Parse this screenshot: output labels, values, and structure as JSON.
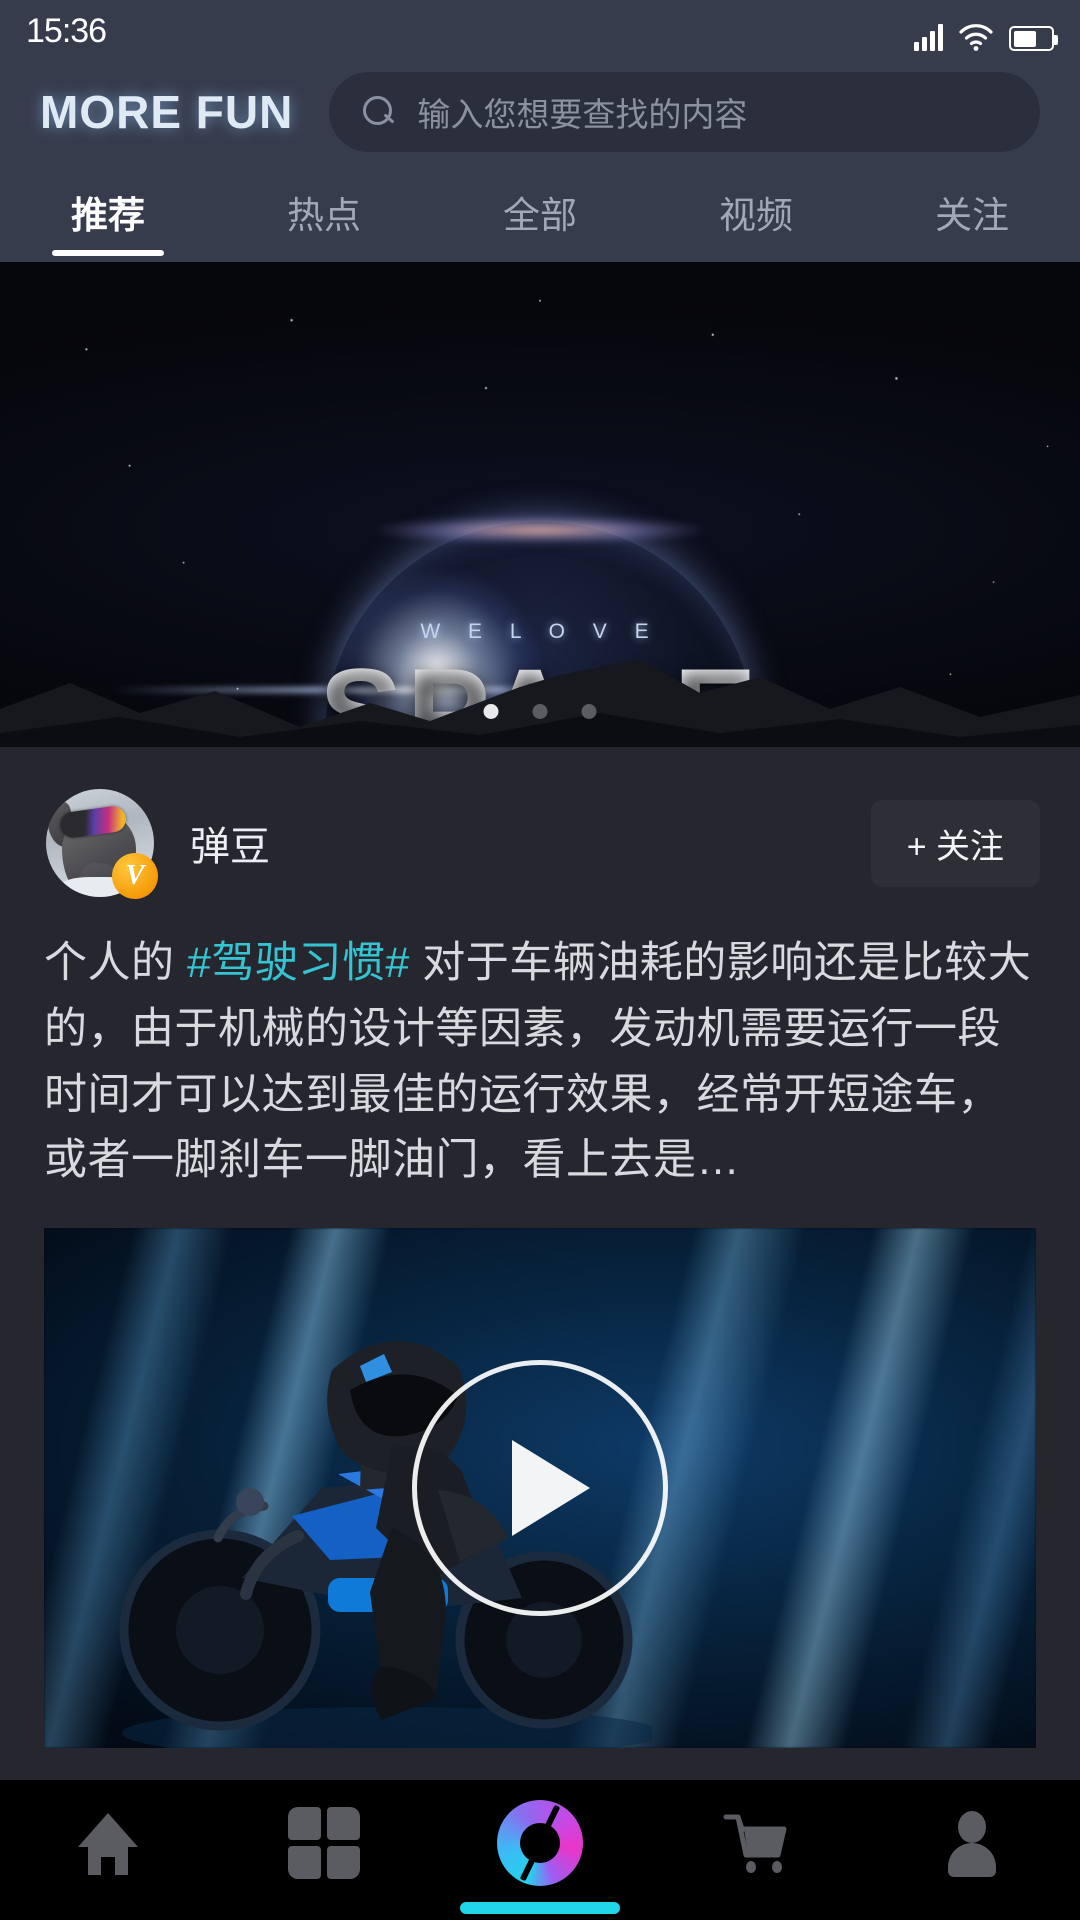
{
  "statusbar": {
    "time": "15:36",
    "signal_icon": "cellular-signal-icon",
    "wifi_icon": "wifi-icon",
    "battery_icon": "battery-icon",
    "battery_level_percent": 62
  },
  "header": {
    "logo": "MORE FUN",
    "search": {
      "icon": "search-icon",
      "placeholder": "输入您想要查找的内容",
      "value": ""
    }
  },
  "tabs": {
    "active_index": 0,
    "items": [
      {
        "label": "推荐"
      },
      {
        "label": "热点"
      },
      {
        "label": "全部"
      },
      {
        "label": "视频"
      },
      {
        "label": "关注"
      }
    ]
  },
  "banner": {
    "subtitle": "W E   L O V E",
    "title": "SPACE",
    "dots_total": 3,
    "dots_active": 1
  },
  "post": {
    "author": {
      "name": "弹豆",
      "avatar_icon": "dog-avatar",
      "verified_badge": "V"
    },
    "follow_button": "+ 关注",
    "text_before": "个人的 ",
    "hashtag": "#驾驶习惯#",
    "text_after": " 对于车辆油耗的影响还是比较大的，由于机械的设计等因素，发动机需要运行一段时间才可以达到最佳的运行效果，经常开短途车，或者一脚刹车一脚油门，看上去是…",
    "media": {
      "type": "video",
      "play_icon": "play-icon",
      "thumbnail_alt": "motorcycle-rider-night"
    }
  },
  "bottomnav": {
    "active_index": 2,
    "items": [
      {
        "icon": "home-icon",
        "label": ""
      },
      {
        "icon": "grid-icon",
        "label": ""
      },
      {
        "icon": "aperture-icon",
        "label": ""
      },
      {
        "icon": "cart-icon",
        "label": ""
      },
      {
        "icon": "profile-icon",
        "label": ""
      }
    ]
  },
  "colors": {
    "header_bg": "#373c4d",
    "content_bg": "#26262e",
    "nav_bg": "#000000",
    "accent_cyan": "#34c4d2",
    "home_indicator": "#1fd7e8",
    "badge_orange": "#f59b09",
    "tab_active": "#ffffff",
    "tab_inactive": "#a3a8b6"
  }
}
